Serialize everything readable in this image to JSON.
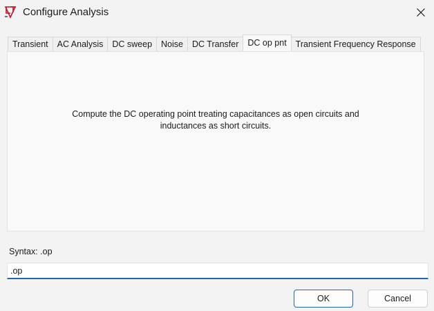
{
  "window": {
    "title": "Configure Analysis",
    "icon": "ltspice-app-icon",
    "close_icon": "close-icon"
  },
  "tabs": [
    {
      "label": "Transient",
      "active": false
    },
    {
      "label": "AC Analysis",
      "active": false
    },
    {
      "label": "DC sweep",
      "active": false
    },
    {
      "label": "Noise",
      "active": false
    },
    {
      "label": "DC Transfer",
      "active": false
    },
    {
      "label": "DC op pnt",
      "active": true
    },
    {
      "label": "Transient Frequency Response",
      "active": false
    }
  ],
  "panel": {
    "line1": "Compute the DC operating point treating capacitances as open circuits and",
    "line2": "inductances as short circuits."
  },
  "syntax": {
    "label": "Syntax: .op",
    "value": ".op"
  },
  "buttons": {
    "ok_label": "OK",
    "cancel_label": "Cancel"
  },
  "colors": {
    "accent": "#1e65b4",
    "window_bg": "#f3f3f3",
    "panel_bg": "#f9f9f9",
    "icon_red": "#c8102e"
  }
}
